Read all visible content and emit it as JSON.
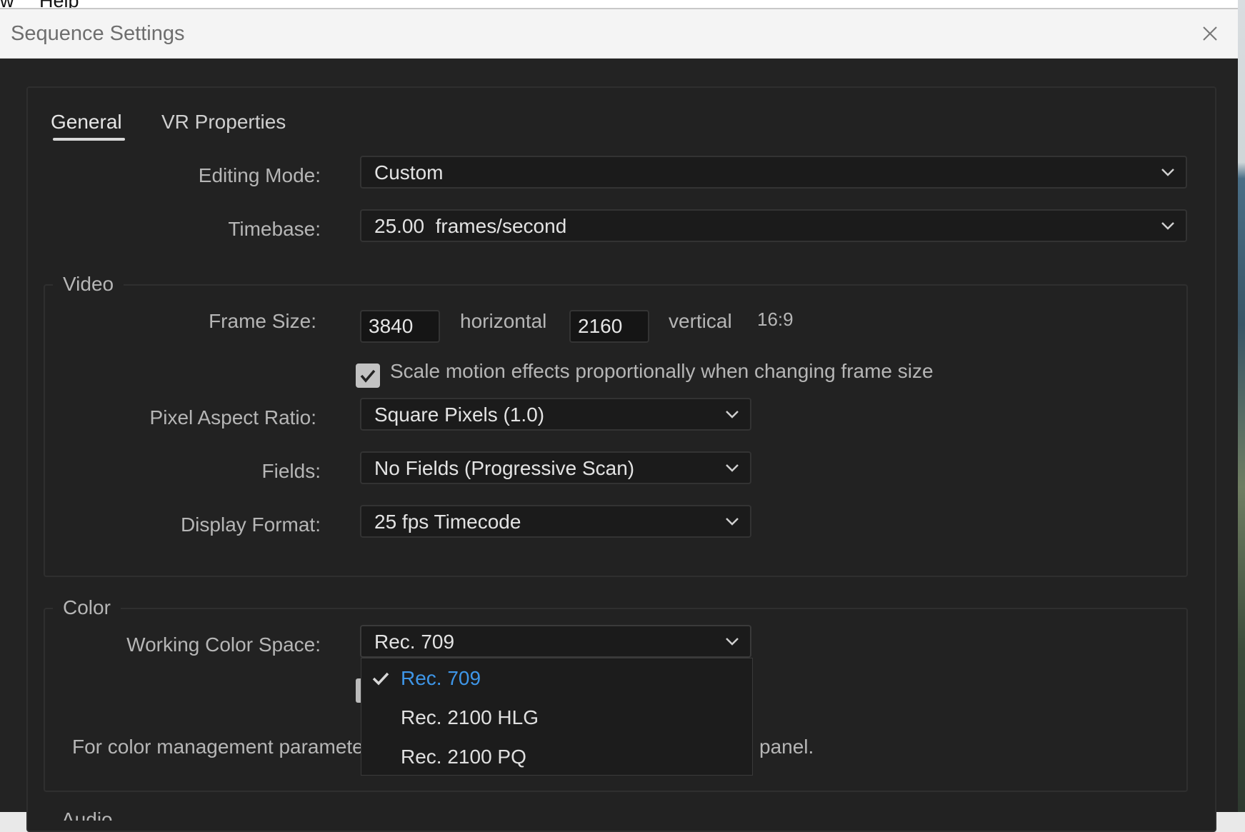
{
  "app_menu": {
    "left_fragment": "w",
    "help": "Help"
  },
  "dialog": {
    "title": "Sequence Settings",
    "close_icon": "close-icon"
  },
  "tabs": [
    {
      "label": "General",
      "active": true
    },
    {
      "label": "VR Properties",
      "active": false
    }
  ],
  "general": {
    "editing_mode": {
      "label": "Editing Mode:",
      "value": "Custom"
    },
    "timebase": {
      "label": "Timebase:",
      "value": "25.00  frames/second"
    }
  },
  "video": {
    "legend": "Video",
    "frame_size": {
      "label": "Frame Size:",
      "horizontal_value": "3840",
      "horizontal_label": "horizontal",
      "vertical_value": "2160",
      "vertical_label": "vertical",
      "aspect": "16:9"
    },
    "scale_motion": {
      "checked": true,
      "label": "Scale motion effects proportionally when changing frame size"
    },
    "pixel_aspect_ratio": {
      "label": "Pixel Aspect Ratio:",
      "value": "Square Pixels (1.0)"
    },
    "fields": {
      "label": "Fields:",
      "value": "No Fields (Progressive Scan)"
    },
    "display_format": {
      "label": "Display Format:",
      "value": "25 fps Timecode"
    }
  },
  "color": {
    "legend": "Color",
    "working_color_space": {
      "label": "Working Color Space:",
      "value": "Rec. 709",
      "options": [
        {
          "label": "Rec. 709",
          "selected": true
        },
        {
          "label": "Rec. 2100 HLG",
          "selected": false
        },
        {
          "label": "Rec. 2100 PQ",
          "selected": false
        }
      ]
    },
    "note_left": "For color management paramete",
    "note_right": "panel."
  },
  "audio": {
    "legend": "Audio"
  },
  "colors": {
    "dialog_bg": "#232323",
    "titlebar_bg": "#f4f4f4",
    "accent_selected": "#3e96e8"
  }
}
